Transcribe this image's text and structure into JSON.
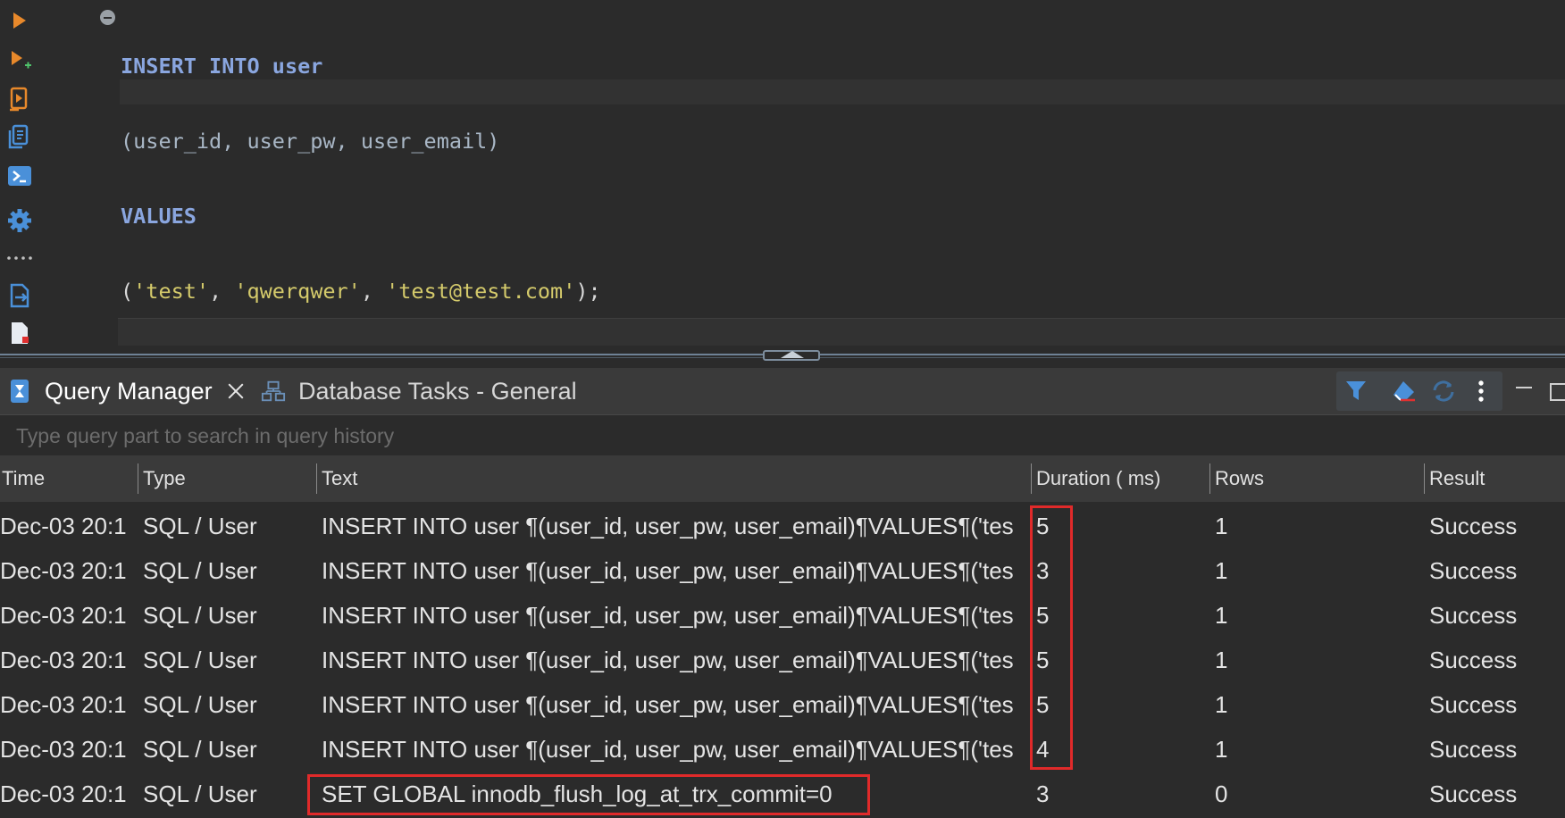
{
  "editor": {
    "code": {
      "line1_kw1": "INSERT",
      "line1_kw2": "INTO",
      "line1_kw3": "user",
      "line2": "(user_id, user_pw, user_email)",
      "line3_kw": "VALUES",
      "line4_open": "(",
      "line4_s1": "'test'",
      "line4_c1": ", ",
      "line4_s2": "'qwerqwer'",
      "line4_c2": ", ",
      "line4_s3": "'test@test.com'",
      "line4_close": ");"
    },
    "tools": [
      "execute-icon",
      "execute-new-tab-icon",
      "execute-script-icon",
      "explain-plan-icon",
      "open-console-icon",
      "settings-icon",
      "more-icon",
      "export-icon",
      "load-file-icon"
    ]
  },
  "tabs": [
    {
      "label": "Query Manager",
      "icon": "query-manager-icon",
      "active": true
    },
    {
      "label": "Database Tasks - General",
      "icon": "database-tasks-icon",
      "active": false
    }
  ],
  "toolbar": {
    "buttons": [
      "filter-icon",
      "clear-icon",
      "refresh-icon",
      "menu-icon",
      "minimize-icon",
      "maximize-icon"
    ]
  },
  "search": {
    "placeholder": "Type query part to search in query history"
  },
  "table": {
    "columns": [
      "Time",
      "Type",
      "Text",
      "Duration ( ms)",
      "Rows",
      "Result"
    ],
    "rows": [
      {
        "time": "Dec-03 20:1",
        "type": "SQL / User",
        "text": "INSERT INTO user ¶(user_id, user_pw, user_email)¶VALUES¶('tes",
        "duration": "5",
        "rows": "1",
        "result": "Success"
      },
      {
        "time": "Dec-03 20:1",
        "type": "SQL / User",
        "text": "INSERT INTO user ¶(user_id, user_pw, user_email)¶VALUES¶('tes",
        "duration": "3",
        "rows": "1",
        "result": "Success"
      },
      {
        "time": "Dec-03 20:1",
        "type": "SQL / User",
        "text": "INSERT INTO user ¶(user_id, user_pw, user_email)¶VALUES¶('tes",
        "duration": "5",
        "rows": "1",
        "result": "Success"
      },
      {
        "time": "Dec-03 20:1",
        "type": "SQL / User",
        "text": "INSERT INTO user ¶(user_id, user_pw, user_email)¶VALUES¶('tes",
        "duration": "5",
        "rows": "1",
        "result": "Success"
      },
      {
        "time": "Dec-03 20:1",
        "type": "SQL / User",
        "text": "INSERT INTO user ¶(user_id, user_pw, user_email)¶VALUES¶('tes",
        "duration": "5",
        "rows": "1",
        "result": "Success"
      },
      {
        "time": "Dec-03 20:1",
        "type": "SQL / User",
        "text": "INSERT INTO user ¶(user_id, user_pw, user_email)¶VALUES¶('tes",
        "duration": "4",
        "rows": "1",
        "result": "Success"
      },
      {
        "time": "Dec-03 20:1",
        "type": "SQL / User",
        "text": "SET GLOBAL innodb_flush_log_at_trx_commit=0",
        "duration": "3",
        "rows": "0",
        "result": "Success"
      }
    ]
  },
  "colors": {
    "highlight": "#e02a2a",
    "keyword": "#8aa6df",
    "string": "#d4ca6b",
    "accent": "#3d8fd6"
  }
}
